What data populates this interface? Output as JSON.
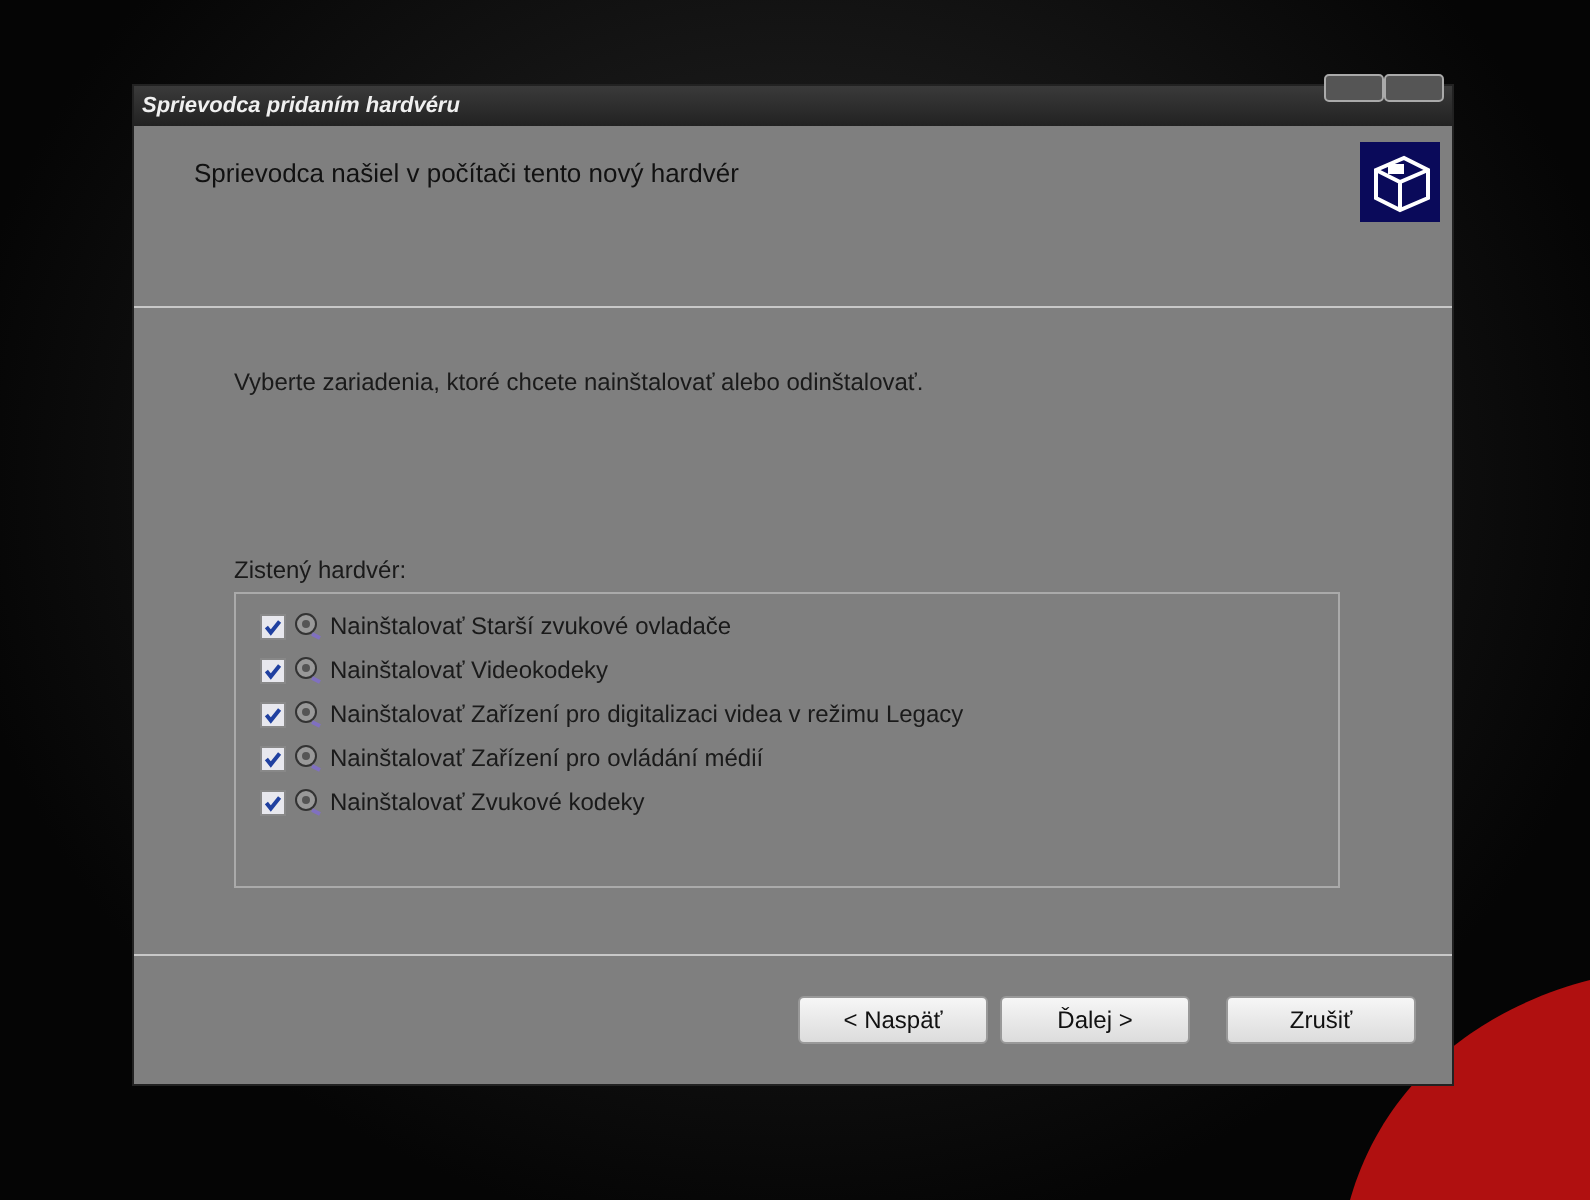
{
  "window": {
    "title": "Sprievodca pridaním hardvéru"
  },
  "header": {
    "title": "Sprievodca našiel v počítači tento nový hardvér"
  },
  "instruction": "Vyberte zariadenia, ktoré chcete nainštalovať alebo odinštalovať.",
  "hardware_list": {
    "label": "Zistený hardvér:",
    "items": [
      {
        "label": "Nainštalovať Starší zvukové ovladače",
        "checked": true
      },
      {
        "label": "Nainštalovať Videokodeky",
        "checked": true
      },
      {
        "label": "Nainštalovať Zařízení pro digitalizaci videa v režimu Legacy",
        "checked": true
      },
      {
        "label": "Nainštalovať Zařízení pro ovládání médií",
        "checked": true
      },
      {
        "label": "Nainštalovať Zvukové kodeky",
        "checked": true
      }
    ]
  },
  "buttons": [
    {
      "label": "< Naspäť"
    },
    {
      "label": "Ďalej >"
    },
    {
      "label": "Zrušiť"
    }
  ]
}
